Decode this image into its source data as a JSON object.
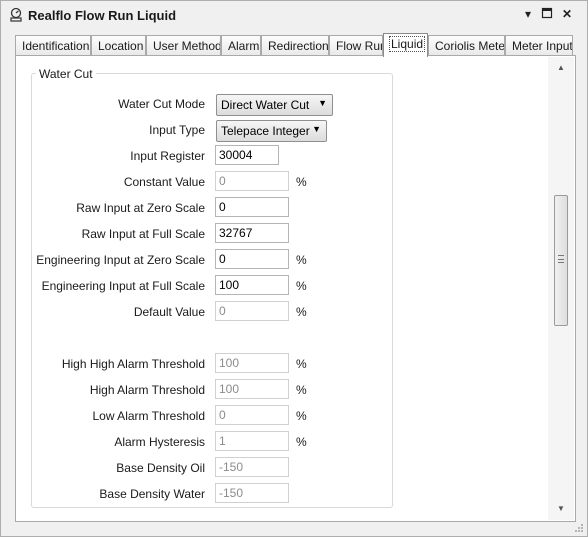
{
  "window": {
    "title": "Realflo Flow Run Liquid",
    "pin_glyph": "▾",
    "maximize_glyph": "▫",
    "close_glyph": "✕"
  },
  "tabs": [
    {
      "label": "Identification",
      "active": false
    },
    {
      "label": "Location",
      "active": false
    },
    {
      "label": "User Methods",
      "active": false
    },
    {
      "label": "Alarm",
      "active": false
    },
    {
      "label": "Redirection",
      "active": false
    },
    {
      "label": "Flow Run",
      "active": false
    },
    {
      "label": "Liquid",
      "active": true
    },
    {
      "label": "Coriolis Meter",
      "active": false
    },
    {
      "label": "Meter Input",
      "active": false
    }
  ],
  "group": {
    "title": "Water Cut",
    "water_cut_mode": {
      "label": "Water Cut Mode",
      "value": "Direct Water Cut"
    },
    "input_type": {
      "label": "Input Type",
      "value": "Telepace Integer"
    },
    "input_register": {
      "label": "Input Register",
      "value": "30004"
    },
    "constant_value": {
      "label": "Constant Value",
      "value": "0",
      "unit": "%"
    },
    "raw_zero": {
      "label": "Raw Input at Zero Scale",
      "value": "0"
    },
    "raw_full": {
      "label": "Raw Input at Full Scale",
      "value": "32767"
    },
    "eng_zero": {
      "label": "Engineering Input at Zero Scale",
      "value": "0",
      "unit": "%"
    },
    "eng_full": {
      "label": "Engineering Input at Full Scale",
      "value": "100",
      "unit": "%"
    },
    "default_value": {
      "label": "Default Value",
      "value": "0",
      "unit": "%"
    },
    "high_high_alarm": {
      "label": "High High Alarm Threshold",
      "value": "100",
      "unit": "%"
    },
    "high_alarm": {
      "label": "High Alarm Threshold",
      "value": "100",
      "unit": "%"
    },
    "low_alarm": {
      "label": "Low Alarm Threshold",
      "value": "0",
      "unit": "%"
    },
    "alarm_hysteresis": {
      "label": "Alarm Hysteresis",
      "value": "1",
      "unit": "%"
    },
    "base_density_oil": {
      "label": "Base Density Oil",
      "value": "-150"
    },
    "base_density_water": {
      "label": "Base Density Water",
      "value": "-150"
    }
  },
  "icons": {
    "app": "flow-meter-icon",
    "combo_arrow": "▼",
    "scroll_up": "▲",
    "scroll_down": "▼"
  },
  "colors": {
    "window_bg": "#f0f0f0",
    "panel_bg": "#ffffff",
    "disabled_text": "#8c8c8c"
  }
}
